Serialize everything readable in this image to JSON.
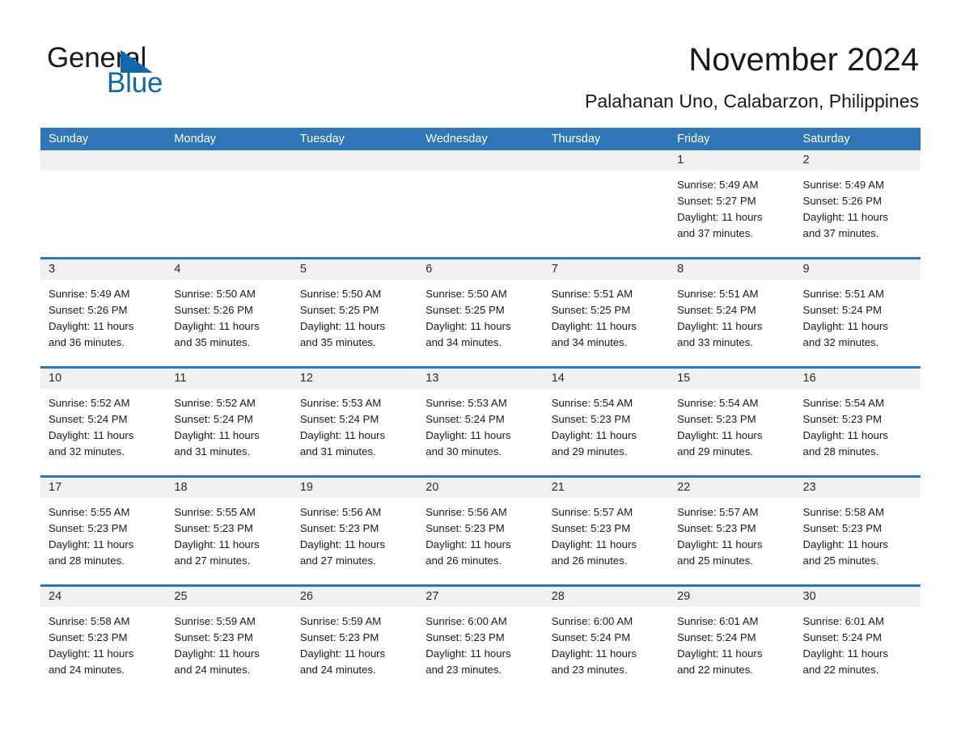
{
  "brand": {
    "name_part1": "General",
    "name_part2": "Blue",
    "triangle_icon": "triangle-logo-icon",
    "accent_color": "#1068ab"
  },
  "header": {
    "title": "November 2024",
    "subtitle": "Palahanan Uno, Calabarzon, Philippines"
  },
  "theme": {
    "header_blue": "#2e76b5",
    "day_band_grey": "#f1f1f1",
    "text": "#1a1a1a"
  },
  "weekdays": [
    "Sunday",
    "Monday",
    "Tuesday",
    "Wednesday",
    "Thursday",
    "Friday",
    "Saturday"
  ],
  "weeks": [
    [
      {
        "day": "",
        "lines": []
      },
      {
        "day": "",
        "lines": []
      },
      {
        "day": "",
        "lines": []
      },
      {
        "day": "",
        "lines": []
      },
      {
        "day": "",
        "lines": []
      },
      {
        "day": "1",
        "lines": [
          "Sunrise: 5:49 AM",
          "Sunset: 5:27 PM",
          "Daylight: 11 hours",
          "and 37 minutes."
        ]
      },
      {
        "day": "2",
        "lines": [
          "Sunrise: 5:49 AM",
          "Sunset: 5:26 PM",
          "Daylight: 11 hours",
          "and 37 minutes."
        ]
      }
    ],
    [
      {
        "day": "3",
        "lines": [
          "Sunrise: 5:49 AM",
          "Sunset: 5:26 PM",
          "Daylight: 11 hours",
          "and 36 minutes."
        ]
      },
      {
        "day": "4",
        "lines": [
          "Sunrise: 5:50 AM",
          "Sunset: 5:26 PM",
          "Daylight: 11 hours",
          "and 35 minutes."
        ]
      },
      {
        "day": "5",
        "lines": [
          "Sunrise: 5:50 AM",
          "Sunset: 5:25 PM",
          "Daylight: 11 hours",
          "and 35 minutes."
        ]
      },
      {
        "day": "6",
        "lines": [
          "Sunrise: 5:50 AM",
          "Sunset: 5:25 PM",
          "Daylight: 11 hours",
          "and 34 minutes."
        ]
      },
      {
        "day": "7",
        "lines": [
          "Sunrise: 5:51 AM",
          "Sunset: 5:25 PM",
          "Daylight: 11 hours",
          "and 34 minutes."
        ]
      },
      {
        "day": "8",
        "lines": [
          "Sunrise: 5:51 AM",
          "Sunset: 5:24 PM",
          "Daylight: 11 hours",
          "and 33 minutes."
        ]
      },
      {
        "day": "9",
        "lines": [
          "Sunrise: 5:51 AM",
          "Sunset: 5:24 PM",
          "Daylight: 11 hours",
          "and 32 minutes."
        ]
      }
    ],
    [
      {
        "day": "10",
        "lines": [
          "Sunrise: 5:52 AM",
          "Sunset: 5:24 PM",
          "Daylight: 11 hours",
          "and 32 minutes."
        ]
      },
      {
        "day": "11",
        "lines": [
          "Sunrise: 5:52 AM",
          "Sunset: 5:24 PM",
          "Daylight: 11 hours",
          "and 31 minutes."
        ]
      },
      {
        "day": "12",
        "lines": [
          "Sunrise: 5:53 AM",
          "Sunset: 5:24 PM",
          "Daylight: 11 hours",
          "and 31 minutes."
        ]
      },
      {
        "day": "13",
        "lines": [
          "Sunrise: 5:53 AM",
          "Sunset: 5:24 PM",
          "Daylight: 11 hours",
          "and 30 minutes."
        ]
      },
      {
        "day": "14",
        "lines": [
          "Sunrise: 5:54 AM",
          "Sunset: 5:23 PM",
          "Daylight: 11 hours",
          "and 29 minutes."
        ]
      },
      {
        "day": "15",
        "lines": [
          "Sunrise: 5:54 AM",
          "Sunset: 5:23 PM",
          "Daylight: 11 hours",
          "and 29 minutes."
        ]
      },
      {
        "day": "16",
        "lines": [
          "Sunrise: 5:54 AM",
          "Sunset: 5:23 PM",
          "Daylight: 11 hours",
          "and 28 minutes."
        ]
      }
    ],
    [
      {
        "day": "17",
        "lines": [
          "Sunrise: 5:55 AM",
          "Sunset: 5:23 PM",
          "Daylight: 11 hours",
          "and 28 minutes."
        ]
      },
      {
        "day": "18",
        "lines": [
          "Sunrise: 5:55 AM",
          "Sunset: 5:23 PM",
          "Daylight: 11 hours",
          "and 27 minutes."
        ]
      },
      {
        "day": "19",
        "lines": [
          "Sunrise: 5:56 AM",
          "Sunset: 5:23 PM",
          "Daylight: 11 hours",
          "and 27 minutes."
        ]
      },
      {
        "day": "20",
        "lines": [
          "Sunrise: 5:56 AM",
          "Sunset: 5:23 PM",
          "Daylight: 11 hours",
          "and 26 minutes."
        ]
      },
      {
        "day": "21",
        "lines": [
          "Sunrise: 5:57 AM",
          "Sunset: 5:23 PM",
          "Daylight: 11 hours",
          "and 26 minutes."
        ]
      },
      {
        "day": "22",
        "lines": [
          "Sunrise: 5:57 AM",
          "Sunset: 5:23 PM",
          "Daylight: 11 hours",
          "and 25 minutes."
        ]
      },
      {
        "day": "23",
        "lines": [
          "Sunrise: 5:58 AM",
          "Sunset: 5:23 PM",
          "Daylight: 11 hours",
          "and 25 minutes."
        ]
      }
    ],
    [
      {
        "day": "24",
        "lines": [
          "Sunrise: 5:58 AM",
          "Sunset: 5:23 PM",
          "Daylight: 11 hours",
          "and 24 minutes."
        ]
      },
      {
        "day": "25",
        "lines": [
          "Sunrise: 5:59 AM",
          "Sunset: 5:23 PM",
          "Daylight: 11 hours",
          "and 24 minutes."
        ]
      },
      {
        "day": "26",
        "lines": [
          "Sunrise: 5:59 AM",
          "Sunset: 5:23 PM",
          "Daylight: 11 hours",
          "and 24 minutes."
        ]
      },
      {
        "day": "27",
        "lines": [
          "Sunrise: 6:00 AM",
          "Sunset: 5:23 PM",
          "Daylight: 11 hours",
          "and 23 minutes."
        ]
      },
      {
        "day": "28",
        "lines": [
          "Sunrise: 6:00 AM",
          "Sunset: 5:24 PM",
          "Daylight: 11 hours",
          "and 23 minutes."
        ]
      },
      {
        "day": "29",
        "lines": [
          "Sunrise: 6:01 AM",
          "Sunset: 5:24 PM",
          "Daylight: 11 hours",
          "and 22 minutes."
        ]
      },
      {
        "day": "30",
        "lines": [
          "Sunrise: 6:01 AM",
          "Sunset: 5:24 PM",
          "Daylight: 11 hours",
          "and 22 minutes."
        ]
      }
    ]
  ]
}
